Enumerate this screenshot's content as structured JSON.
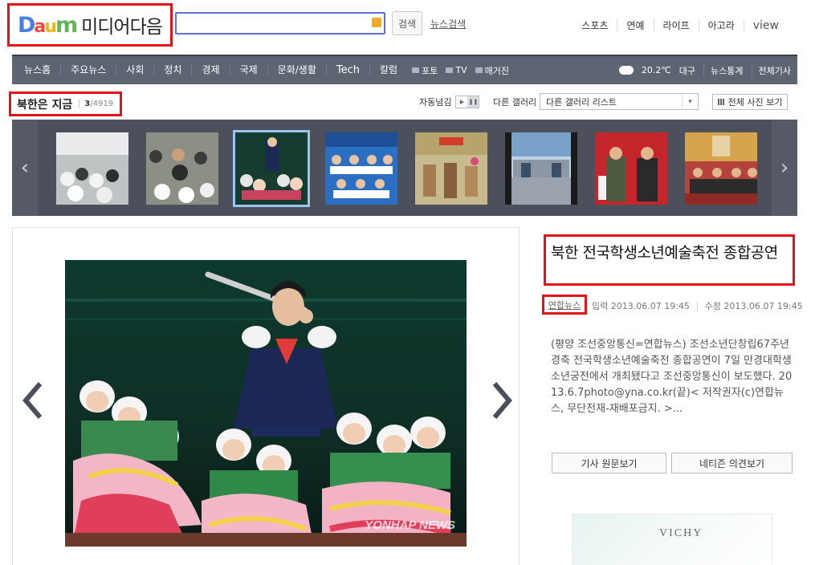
{
  "header": {
    "logo_text": "미디어다음",
    "search": {
      "value": "",
      "placeholder": ""
    },
    "search_button": "검색",
    "news_search_link": "뉴스검색",
    "top_links": [
      "스포츠",
      "연예",
      "라이프",
      "아고라",
      "view"
    ]
  },
  "nav": {
    "items": [
      "뉴스홈",
      "주요뉴스",
      "사회",
      "정치",
      "경제",
      "국제",
      "문화/생활",
      "Tech",
      "칼럼"
    ],
    "media": [
      "포토",
      "TV",
      "매거진"
    ],
    "weather_temp": "20.2℃",
    "weather_city": "대구",
    "stats": "뉴스통계",
    "all_articles": "전체기사"
  },
  "gallery": {
    "title": "북한은 지금",
    "current": "3",
    "total": "/4919",
    "autoplay_label": "자동넘김",
    "other_gallery_label": "다른 갤러리",
    "select_value": "다른 갤러리 리스트",
    "view_all": "전체 사진 보기"
  },
  "article": {
    "headline": "북한 전국학생소년예술축전 종합공연",
    "source": "연합뉴스",
    "input_label": "입력",
    "input_date": "2013.06.07 19:45",
    "edit_label": "수정",
    "edit_date": "2013.06.07 19:45",
    "body": "(평양 조선중앙통신=연합뉴스) 조선소년단창립67주년 경축 전국학생소년예술축전 종합공연이 7일 만경대학생소년궁전에서 개최됐다고 조선중앙통신이 보도했다. 2013.6.7photo@yna.co.kr(끝)< 저작권자(c)연합뉴스, 무단전재-재배포금지. >...",
    "btn_original": "기사 원문보기",
    "btn_opinion": "네티즌 의견보기"
  },
  "photo": {
    "watermark": "YONHAP NEWS"
  },
  "ad": {
    "brand": "VICHY"
  },
  "colors": {
    "annotation_red": "#e3121b",
    "nav_bg": "#5d6472",
    "strip_bg": "#4b505a",
    "search_border": "#5a73d6"
  }
}
